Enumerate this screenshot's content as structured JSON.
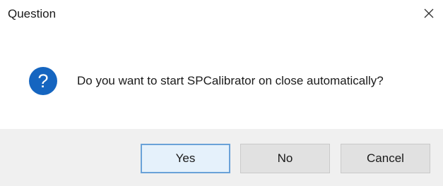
{
  "window": {
    "title": "Question",
    "close_glyph": "✕"
  },
  "content": {
    "icon": "question-icon",
    "icon_glyph": "?",
    "icon_color": "#1565c0",
    "message": "Do you want to start SPCalibrator on close automatically?"
  },
  "buttons": {
    "yes_label": "Yes",
    "no_label": "No",
    "cancel_label": "Cancel"
  },
  "colors": {
    "footer_bg": "#f0f0f0",
    "default_button_border": "#6aa2d8"
  }
}
